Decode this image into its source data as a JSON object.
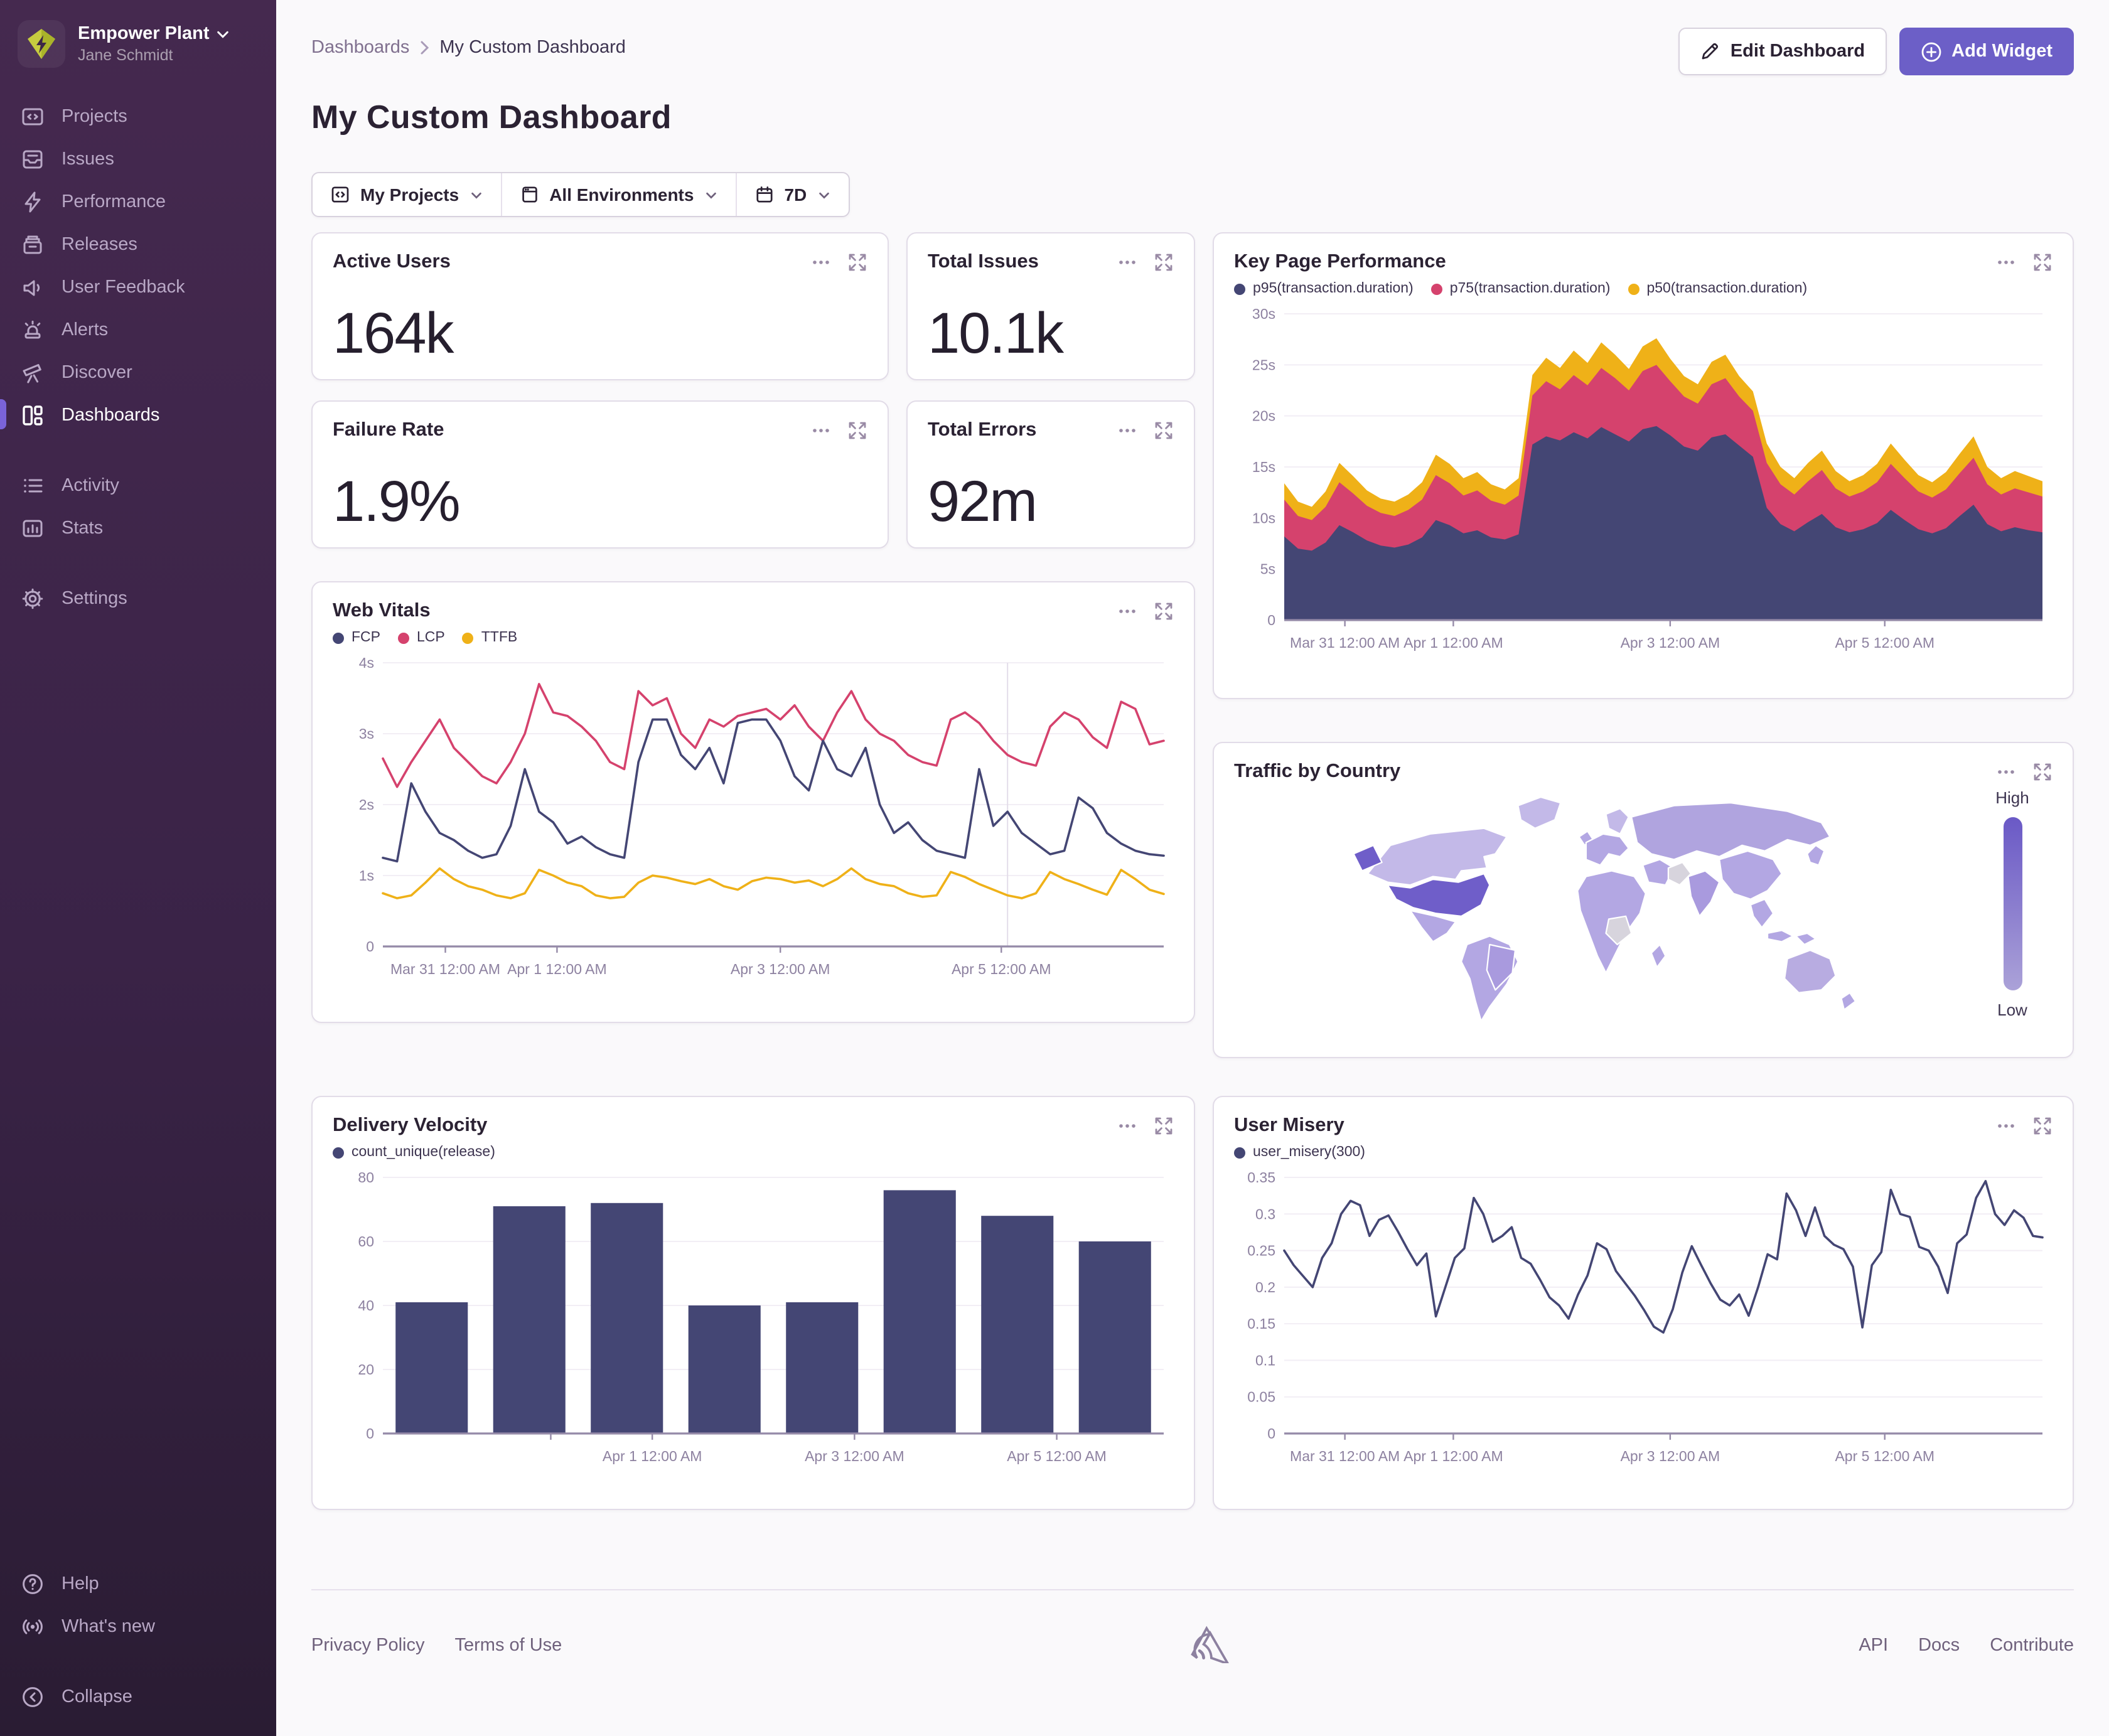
{
  "colors": {
    "accent": "#6c5fc7",
    "navy": "#444674",
    "pink": "#d5426d",
    "yellow": "#efb118"
  },
  "sidebar": {
    "org": "Empower Plant",
    "user": "Jane Schmidt",
    "items": [
      {
        "label": "Projects"
      },
      {
        "label": "Issues"
      },
      {
        "label": "Performance"
      },
      {
        "label": "Releases"
      },
      {
        "label": "User Feedback"
      },
      {
        "label": "Alerts"
      },
      {
        "label": "Discover"
      },
      {
        "label": "Dashboards"
      },
      {
        "label": "Activity"
      },
      {
        "label": "Stats"
      },
      {
        "label": "Settings"
      }
    ],
    "bottom": [
      {
        "label": "Help"
      },
      {
        "label": "What's new"
      },
      {
        "label": "Collapse"
      }
    ]
  },
  "header": {
    "breadcrumb_root": "Dashboards",
    "breadcrumb_current": "My Custom Dashboard",
    "title": "My Custom Dashboard",
    "edit_label": "Edit Dashboard",
    "add_label": "Add Widget"
  },
  "filters": {
    "projects": "My Projects",
    "environments": "All Environments",
    "date": "7D"
  },
  "stats": [
    {
      "title": "Active Users",
      "value": "164k"
    },
    {
      "title": "Total Issues",
      "value": "10.1k"
    },
    {
      "title": "Failure Rate",
      "value": "1.9%"
    },
    {
      "title": "Total Errors",
      "value": "92m"
    }
  ],
  "map": {
    "title": "Traffic by Country",
    "high": "High",
    "low": "Low"
  },
  "footer": {
    "privacy": "Privacy Policy",
    "terms": "Terms of Use",
    "api": "API",
    "docs": "Docs",
    "contribute": "Contribute"
  },
  "chart_data": [
    {
      "id": "kpp",
      "type": "area-stacked",
      "title": "Key Page Performance",
      "legend": [
        {
          "label": "p95(transaction.duration)",
          "color": "#444674"
        },
        {
          "label": "p75(transaction.duration)",
          "color": "#d5426d"
        },
        {
          "label": "p50(transaction.duration)",
          "color": "#efb118"
        }
      ],
      "ylim": [
        0,
        30
      ],
      "yticks": [
        [
          0,
          "0"
        ],
        [
          5,
          "5s"
        ],
        [
          10,
          "10s"
        ],
        [
          15,
          "15s"
        ],
        [
          20,
          "20s"
        ],
        [
          25,
          "25s"
        ],
        [
          30,
          "30s"
        ]
      ],
      "xticks": [
        {
          "f": 0.08,
          "label": "Mar 31 12:00 AM"
        },
        {
          "f": 0.223,
          "label": "Apr 1 12:00 AM"
        },
        {
          "f": 0.509,
          "label": "Apr 3 12:00 AM"
        },
        {
          "f": 0.792,
          "label": "Apr 5 12:00 AM"
        }
      ],
      "series": [
        {
          "name": "p95(transaction.duration)",
          "color": "#444674",
          "values": [
            8.2,
            7.0,
            6.8,
            7.6,
            9.3,
            8.6,
            7.8,
            7.3,
            7.1,
            7.4,
            8.1,
            9.8,
            9.3,
            8.5,
            8.8,
            8.1,
            7.9,
            8.4,
            17.2,
            18.0,
            17.6,
            18.4,
            17.8,
            18.9,
            18.2,
            17.5,
            18.7,
            19.0,
            18.1,
            17.0,
            16.6,
            17.9,
            18.2,
            17.1,
            16.0,
            11.0,
            9.4,
            8.7,
            9.6,
            10.4,
            9.1,
            8.6,
            8.9,
            9.5,
            10.8,
            9.8,
            8.9,
            8.5,
            9.0,
            10.2,
            11.3,
            9.4,
            8.7,
            9.1,
            8.8,
            8.6
          ]
        },
        {
          "name": "p75(transaction.duration)",
          "color": "#d5426d",
          "values": [
            3.6,
            3.2,
            3.0,
            3.5,
            4.2,
            3.8,
            3.4,
            3.2,
            3.1,
            3.4,
            3.7,
            4.4,
            4.1,
            3.7,
            3.9,
            3.6,
            3.4,
            3.8,
            4.8,
            5.4,
            5.0,
            5.6,
            5.2,
            5.8,
            5.5,
            5.0,
            5.7,
            6.0,
            5.3,
            4.9,
            4.6,
            5.2,
            5.5,
            4.8,
            4.5,
            4.4,
            3.9,
            3.6,
            4.0,
            4.3,
            3.8,
            3.5,
            3.7,
            4.0,
            4.5,
            4.1,
            3.7,
            3.5,
            3.8,
            4.2,
            4.6,
            3.9,
            3.6,
            3.8,
            3.7,
            3.5
          ]
        },
        {
          "name": "p50(transaction.duration)",
          "color": "#efb118",
          "values": [
            1.6,
            1.4,
            1.3,
            1.5,
            1.9,
            1.7,
            1.5,
            1.4,
            1.4,
            1.5,
            1.7,
            2.0,
            1.9,
            1.7,
            1.8,
            1.6,
            1.5,
            1.7,
            2.0,
            2.3,
            2.1,
            2.4,
            2.2,
            2.5,
            2.3,
            2.1,
            2.4,
            2.6,
            2.2,
            2.0,
            1.9,
            2.2,
            2.3,
            2.0,
            1.9,
            1.9,
            1.7,
            1.6,
            1.8,
            1.9,
            1.7,
            1.5,
            1.6,
            1.8,
            2.0,
            1.8,
            1.6,
            1.5,
            1.7,
            1.9,
            2.1,
            1.7,
            1.6,
            1.7,
            1.6,
            1.5
          ]
        }
      ]
    },
    {
      "id": "wv",
      "type": "line",
      "title": "Web Vitals",
      "legend": [
        {
          "label": "FCP",
          "color": "#444674"
        },
        {
          "label": "LCP",
          "color": "#d5426d"
        },
        {
          "label": "TTFB",
          "color": "#efb118"
        }
      ],
      "ylim": [
        0,
        4
      ],
      "yticks": [
        [
          0,
          "0"
        ],
        [
          1,
          "1s"
        ],
        [
          2,
          "2s"
        ],
        [
          3,
          "3s"
        ],
        [
          4,
          "4s"
        ]
      ],
      "xticks": [
        {
          "f": 0.08,
          "label": "Mar 31 12:00 AM"
        },
        {
          "f": 0.223,
          "label": "Apr 1 12:00 AM"
        },
        {
          "f": 0.509,
          "label": "Apr 3 12:00 AM"
        },
        {
          "f": 0.792,
          "label": "Apr 5 12:00 AM"
        }
      ],
      "cursor_f": 0.8,
      "series": [
        {
          "name": "LCP",
          "color": "#d5426d",
          "values": [
            2.65,
            2.25,
            2.6,
            2.9,
            3.2,
            2.8,
            2.6,
            2.4,
            2.3,
            2.6,
            3.0,
            3.7,
            3.3,
            3.25,
            3.1,
            2.9,
            2.6,
            2.5,
            3.6,
            3.4,
            3.5,
            3.0,
            2.8,
            3.2,
            3.1,
            3.25,
            3.3,
            3.35,
            3.2,
            3.4,
            3.1,
            2.9,
            3.3,
            3.6,
            3.2,
            3.0,
            2.9,
            2.7,
            2.6,
            2.55,
            3.2,
            3.3,
            3.15,
            2.9,
            2.7,
            2.6,
            2.55,
            3.1,
            3.3,
            3.2,
            2.95,
            2.8,
            3.45,
            3.35,
            2.85,
            2.9
          ]
        },
        {
          "name": "FCP",
          "color": "#444674",
          "values": [
            1.25,
            1.2,
            2.3,
            1.9,
            1.6,
            1.5,
            1.35,
            1.25,
            1.3,
            1.7,
            2.5,
            1.9,
            1.75,
            1.45,
            1.55,
            1.4,
            1.3,
            1.25,
            2.6,
            3.2,
            3.2,
            2.7,
            2.5,
            2.8,
            2.3,
            3.15,
            3.2,
            3.2,
            2.9,
            2.4,
            2.2,
            2.9,
            2.5,
            2.4,
            2.8,
            2.0,
            1.6,
            1.75,
            1.5,
            1.35,
            1.3,
            1.25,
            2.5,
            1.7,
            1.9,
            1.6,
            1.45,
            1.3,
            1.35,
            2.1,
            1.95,
            1.6,
            1.45,
            1.35,
            1.3,
            1.28
          ]
        },
        {
          "name": "TTFB",
          "color": "#efb118",
          "values": [
            0.75,
            0.68,
            0.72,
            0.9,
            1.1,
            0.95,
            0.85,
            0.8,
            0.72,
            0.68,
            0.75,
            1.08,
            1.0,
            0.9,
            0.85,
            0.72,
            0.68,
            0.7,
            0.9,
            1.0,
            0.97,
            0.92,
            0.88,
            0.95,
            0.85,
            0.8,
            0.92,
            0.97,
            0.95,
            0.9,
            0.93,
            0.85,
            0.95,
            1.1,
            0.95,
            0.88,
            0.85,
            0.75,
            0.7,
            0.72,
            1.05,
            0.98,
            0.88,
            0.8,
            0.72,
            0.68,
            0.75,
            1.05,
            0.95,
            0.88,
            0.8,
            0.73,
            1.08,
            0.95,
            0.8,
            0.74
          ]
        }
      ]
    },
    {
      "id": "dv",
      "type": "bar",
      "title": "Delivery Velocity",
      "legend": [
        {
          "label": "count_unique(release)",
          "color": "#444674"
        }
      ],
      "ylim": [
        0,
        80
      ],
      "yticks": [
        [
          0,
          "0"
        ],
        [
          20,
          "20"
        ],
        [
          40,
          "40"
        ],
        [
          60,
          "60"
        ],
        [
          80,
          "80"
        ]
      ],
      "xticks": [
        {
          "f": 0.215,
          "label": ""
        },
        {
          "f": 0.345,
          "label": "Apr 1 12:00 AM"
        },
        {
          "f": 0.604,
          "label": "Apr 3 12:00 AM"
        },
        {
          "f": 0.863,
          "label": "Apr 5 12:00 AM"
        }
      ],
      "bar_color": "#444674",
      "values": [
        41,
        71,
        72,
        40,
        41,
        76,
        68,
        60
      ]
    },
    {
      "id": "um",
      "type": "line",
      "title": "User Misery",
      "legend": [
        {
          "label": "user_misery(300)",
          "color": "#444674"
        }
      ],
      "ylim": [
        0,
        0.35
      ],
      "yticks": [
        [
          0,
          "0"
        ],
        [
          0.05,
          "0.05"
        ],
        [
          0.1,
          "0.1"
        ],
        [
          0.15,
          "0.15"
        ],
        [
          0.2,
          "0.2"
        ],
        [
          0.25,
          "0.25"
        ],
        [
          0.3,
          "0.3"
        ],
        [
          0.35,
          "0.35"
        ]
      ],
      "xticks": [
        {
          "f": 0.08,
          "label": "Mar 31 12:00 AM"
        },
        {
          "f": 0.223,
          "label": "Apr 1 12:00 AM"
        },
        {
          "f": 0.509,
          "label": "Apr 3 12:00 AM"
        },
        {
          "f": 0.792,
          "label": "Apr 5 12:00 AM"
        }
      ],
      "series": [
        {
          "name": "user_misery(300)",
          "color": "#444674",
          "values": [
            0.25,
            0.23,
            0.215,
            0.2,
            0.24,
            0.26,
            0.3,
            0.318,
            0.312,
            0.27,
            0.292,
            0.298,
            0.276,
            0.252,
            0.23,
            0.246,
            0.16,
            0.2,
            0.24,
            0.253,
            0.322,
            0.3,
            0.262,
            0.27,
            0.282,
            0.24,
            0.232,
            0.21,
            0.186,
            0.175,
            0.157,
            0.19,
            0.216,
            0.26,
            0.252,
            0.222,
            0.205,
            0.188,
            0.168,
            0.146,
            0.138,
            0.17,
            0.22,
            0.256,
            0.23,
            0.205,
            0.183,
            0.175,
            0.19,
            0.161,
            0.2,
            0.245,
            0.238,
            0.328,
            0.305,
            0.27,
            0.309,
            0.27,
            0.258,
            0.252,
            0.228,
            0.145,
            0.23,
            0.248,
            0.333,
            0.3,
            0.296,
            0.255,
            0.25,
            0.228,
            0.192,
            0.26,
            0.272,
            0.322,
            0.345,
            0.3,
            0.285,
            0.305,
            0.295,
            0.27,
            0.268
          ]
        }
      ]
    }
  ]
}
